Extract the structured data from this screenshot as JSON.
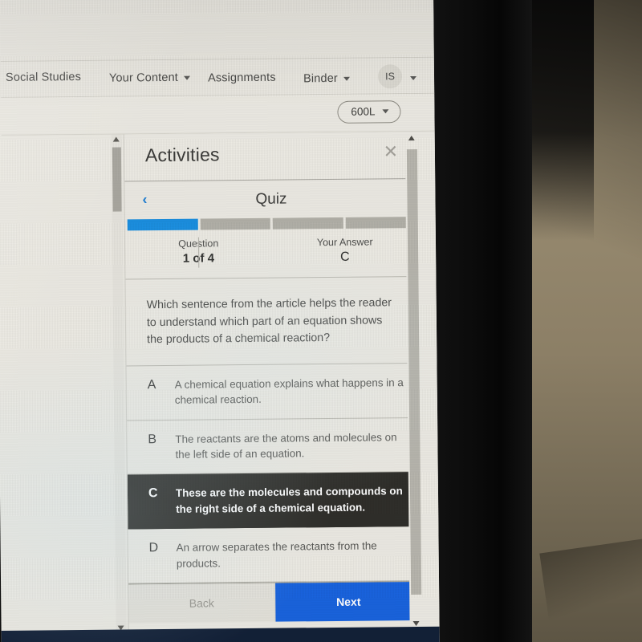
{
  "browser": {
    "extension_icons": [
      "blue-square-icon",
      "red-shield-icon",
      "red-drop-icon",
      "image-badge-icon",
      "note-list-icon",
      "add-box-icon"
    ],
    "profile_avatar": "profile-avatar-icon",
    "overflow_menu": "· · ·"
  },
  "nav": {
    "items": [
      {
        "label": "Social Studies",
        "has_caret": false
      },
      {
        "label": "Your Content",
        "has_caret": true
      },
      {
        "label": "Assignments",
        "has_caret": false
      },
      {
        "label": "Binder",
        "has_caret": true
      }
    ],
    "avatar_initials": "IS"
  },
  "toolbar": {
    "lexile_level": "600L"
  },
  "modal": {
    "title": "Activities",
    "close_label": "✕",
    "back_chevron": "‹",
    "quiz_title": "Quiz",
    "progress": {
      "total_segments": 4,
      "completed_segments": 1
    },
    "meta": {
      "question_label": "Question",
      "question_value": "1 of 4",
      "answer_label": "Your Answer",
      "answer_value": "C"
    },
    "question_text": "Which sentence from the article helps the reader to understand which part of an equation shows the products of a chemical reaction?",
    "choices": [
      {
        "letter": "A",
        "text": "A chemical equation explains what happens in a chemical reaction.",
        "selected": false
      },
      {
        "letter": "B",
        "text": "The reactants are the atoms and molecules on the left side of an equation.",
        "selected": false
      },
      {
        "letter": "C",
        "text": "These are the molecules and compounds on the right side of a chemical equation.",
        "selected": true
      },
      {
        "letter": "D",
        "text": "An arrow separates the reactants from the products.",
        "selected": false
      }
    ],
    "footer": {
      "back_label": "Back",
      "next_label": "Next"
    }
  },
  "colors": {
    "accent_blue": "#1b8fe0",
    "next_button_blue": "#1963de",
    "selected_choice_bg": "#2f2e2a",
    "page_bg": "#eceae3"
  },
  "taskbar": {
    "clock": ""
  }
}
